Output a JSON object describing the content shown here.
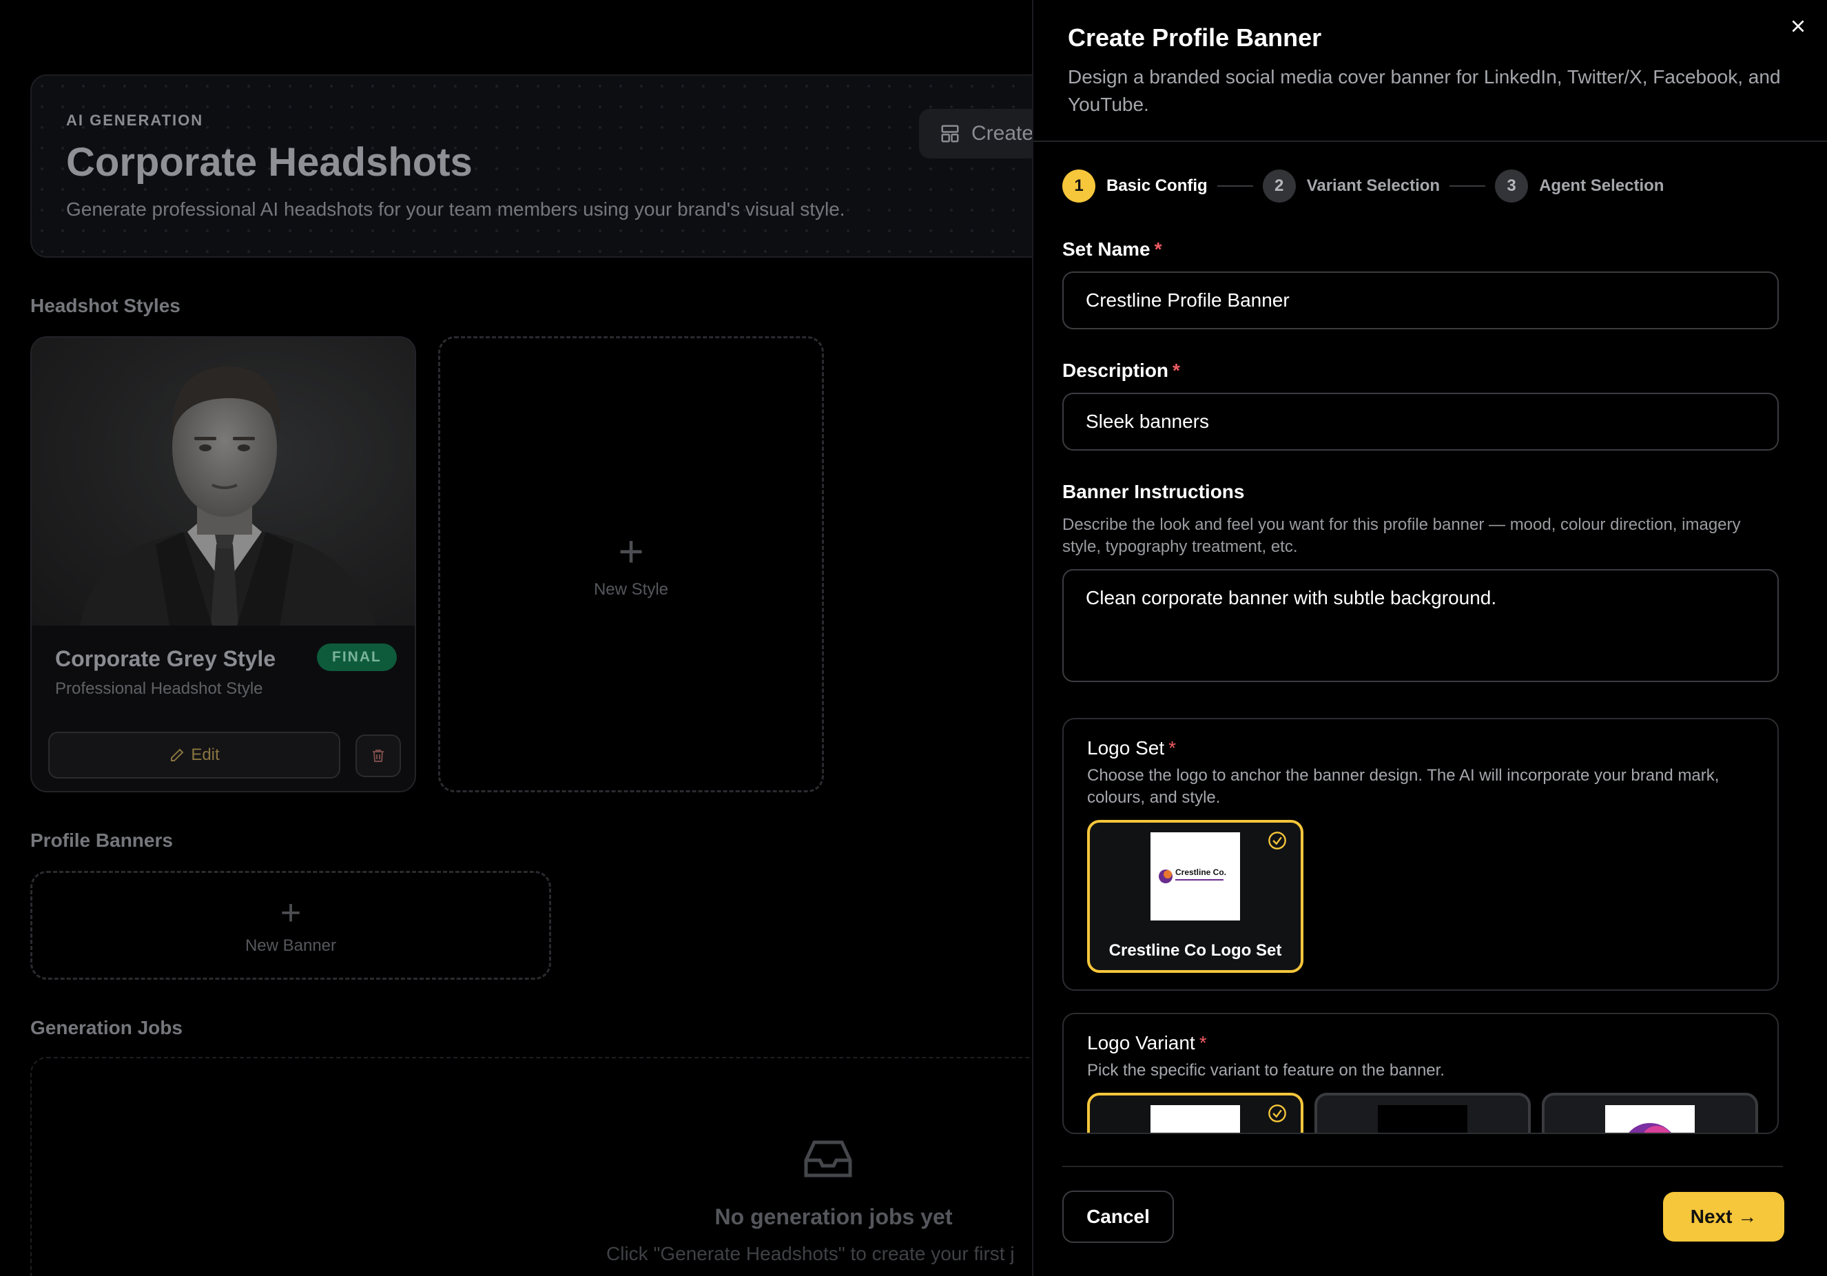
{
  "hero": {
    "eyebrow": "AI GENERATION",
    "title": "Corporate Headshots",
    "subtitle": "Generate professional AI headshots for your team members using your brand's visual style.",
    "create_label": "Create"
  },
  "sections": {
    "headshot_styles": "Headshot Styles",
    "profile_banners": "Profile Banners",
    "generation_jobs": "Generation Jobs"
  },
  "style_card": {
    "name": "Corporate Grey Style",
    "subtitle": "Professional Headshot Style",
    "badge": "FINAL",
    "edit_label": "Edit"
  },
  "new_style_label": "New Style",
  "new_banner_label": "New Banner",
  "jobs_empty": {
    "title": "No generation jobs yet",
    "subtitle": "Click \"Generate Headshots\" to create your first j"
  },
  "drawer": {
    "title": "Create Profile Banner",
    "description": "Design a branded social media cover banner for LinkedIn, Twitter/X, Facebook, and YouTube.",
    "steps": [
      {
        "number": "1",
        "label": "Basic Config"
      },
      {
        "number": "2",
        "label": "Variant Selection"
      },
      {
        "number": "3",
        "label": "Agent Selection"
      }
    ],
    "set_name": {
      "label": "Set Name",
      "required": "*",
      "value": "Crestline Profile Banner"
    },
    "description_field": {
      "label": "Description",
      "required": "*",
      "value": "Sleek banners"
    },
    "banner_instructions": {
      "label": "Banner Instructions",
      "help": "Describe the look and feel you want for this profile banner — mood, colour direction, imagery style, typography treatment, etc.",
      "value": "Clean corporate banner with subtle background."
    },
    "logo_set": {
      "label": "Logo Set",
      "required": "*",
      "help": "Choose the logo to anchor the banner design. The AI will incorporate your brand mark, colours, and style.",
      "option_label": "Crestline Co Logo Set",
      "logo_text": "Crestline Co."
    },
    "logo_variant": {
      "label": "Logo Variant",
      "required": "*",
      "help": "Pick the specific variant to feature on the banner."
    },
    "cancel_label": "Cancel",
    "next_label": "Next →"
  },
  "colors": {
    "accent": "#f6c63b",
    "required": "#ee5b62",
    "final_badge": "#0e5b3c"
  },
  "icons": {
    "close": "close-icon",
    "create": "layout-icon",
    "edit": "pencil-icon",
    "trash": "trash-icon",
    "check": "check-circle-icon",
    "inbox": "inbox-icon"
  }
}
